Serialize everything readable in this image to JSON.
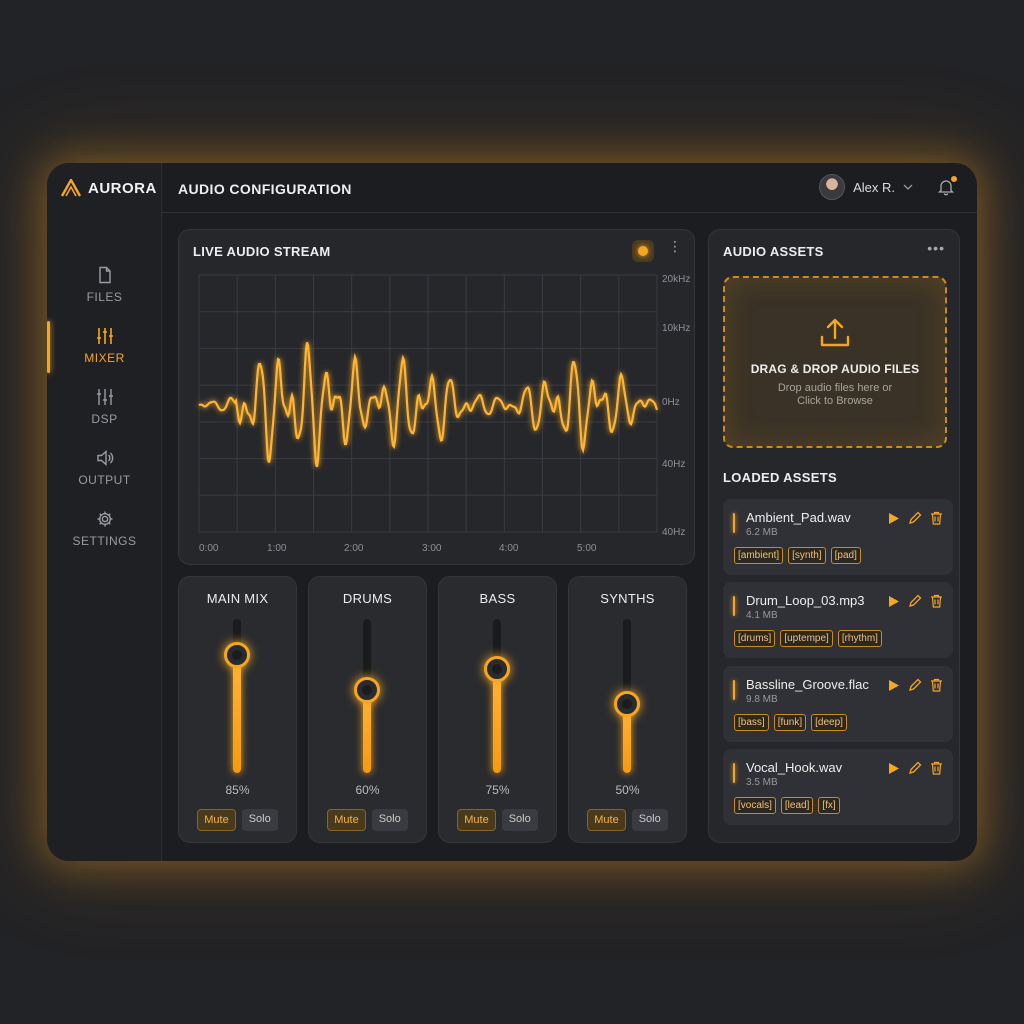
{
  "app": {
    "brand": "AURORA",
    "page_title": "AUDIO CONFIGURATION"
  },
  "user": {
    "name": "Alex R."
  },
  "sidebar": {
    "items": [
      {
        "label": "FILES",
        "icon": "file-icon",
        "active": false
      },
      {
        "label": "MIXER",
        "icon": "sliders-icon",
        "active": true
      },
      {
        "label": "DSP",
        "icon": "sliders-icon",
        "active": false
      },
      {
        "label": "OUTPUT",
        "icon": "speaker-icon",
        "active": false
      },
      {
        "label": "SETTINGS",
        "icon": "gear-icon",
        "active": false
      }
    ]
  },
  "live_stream": {
    "title": "LIVE AUDIO STREAM",
    "y_labels": [
      "20kHz",
      "10kHz",
      "0Hz",
      "40Hz",
      "40Hz"
    ],
    "x_labels": [
      "0:00",
      "1:00",
      "2:00",
      "3:00",
      "4:00",
      "5:00"
    ]
  },
  "channels": [
    {
      "name": "MAIN MIX",
      "level": 85,
      "level_text": "85%",
      "mute": "Mute",
      "solo": "Solo"
    },
    {
      "name": "DRUMS",
      "level": 60,
      "level_text": "60%",
      "mute": "Mute",
      "solo": "Solo"
    },
    {
      "name": "BASS",
      "level": 75,
      "level_text": "75%",
      "mute": "Mute",
      "solo": "Solo"
    },
    {
      "name": "SYNTHS",
      "level": 50,
      "level_text": "50%",
      "mute": "Mute",
      "solo": "Solo"
    }
  ],
  "assets": {
    "title": "AUDIO ASSETS",
    "dropzone": {
      "title": "DRAG & DROP AUDIO FILES",
      "line1": "Drop audio files here or",
      "line2": "Click to Browse"
    },
    "loaded_title": "LOADED ASSETS",
    "items": [
      {
        "name": "Ambient_Pad.wav",
        "size": "6.2 MB",
        "tags": [
          "[ambient]",
          "[synth]",
          "[pad]"
        ]
      },
      {
        "name": "Drum_Loop_03.mp3",
        "size": "4.1 MB",
        "tags": [
          "[drums]",
          "[uptempe]",
          "[rhythm]"
        ]
      },
      {
        "name": "Bassline_Groove.flac",
        "size": "9.8 MB",
        "tags": [
          "[bass]",
          "[funk]",
          "[deep]"
        ]
      },
      {
        "name": "Vocal_Hook.wav",
        "size": "3.5 MB",
        "tags": [
          "[vocals]",
          "[lead]",
          "[fx]"
        ]
      }
    ]
  },
  "colors": {
    "accent": "#f5a623",
    "background": "#222326",
    "panel": "#26272b"
  }
}
